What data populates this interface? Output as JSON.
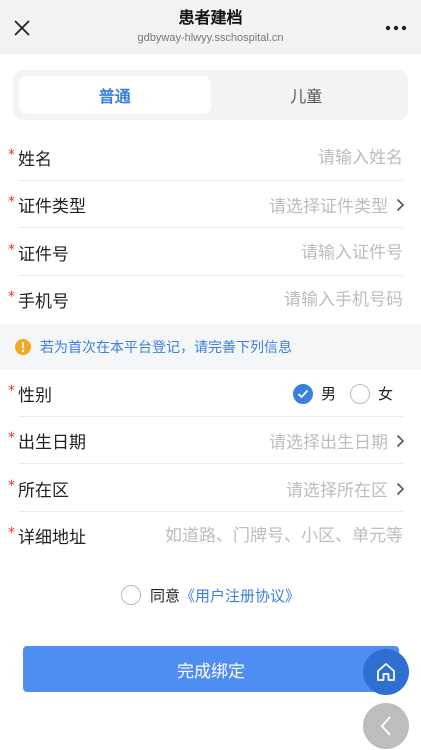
{
  "header": {
    "title": "患者建档",
    "url": "gdbyway-hlwyy.sschospital.cn"
  },
  "tabs": [
    {
      "label": "普通"
    },
    {
      "label": "儿童"
    }
  ],
  "form": {
    "name": {
      "label": "姓名",
      "placeholder": "请输入姓名"
    },
    "id_type": {
      "label": "证件类型",
      "placeholder": "请选择证件类型"
    },
    "id_number": {
      "label": "证件号",
      "placeholder": "请输入证件号"
    },
    "phone": {
      "label": "手机号",
      "placeholder": "请输入手机号码"
    },
    "gender": {
      "label": "性别",
      "options": [
        "男",
        "女"
      ],
      "selected": "男"
    },
    "birth_date": {
      "label": "出生日期",
      "placeholder": "请选择出生日期"
    },
    "region": {
      "label": "所在区",
      "placeholder": "请选择所在区"
    },
    "address": {
      "label": "详细地址",
      "placeholder": "如道路、门牌号、小区、单元等"
    }
  },
  "required_mark": "*",
  "notice": "若为首次在本平台登记，请完善下列信息",
  "agreement": {
    "prefix": "同意",
    "link": "《用户注册协议》"
  },
  "submit_label": "完成绑定",
  "colors": {
    "accent": "#3b7fe0",
    "required": "#e33333",
    "button": "#4d8ef0",
    "notice_icon": "#f5a623"
  }
}
